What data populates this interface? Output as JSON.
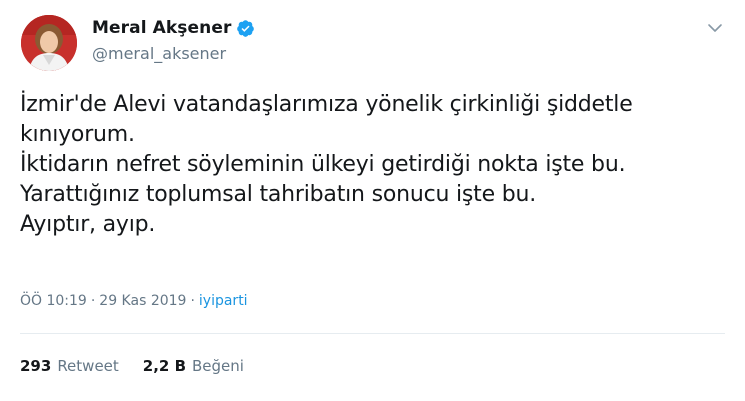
{
  "user": {
    "display_name": "Meral Akşener",
    "handle": "@meral_aksener",
    "verified": true
  },
  "tweet": {
    "lines": [
      "İzmir'de Alevi vatandaşlarımıza yönelik çirkinliği şiddetle",
      "kınıyorum.",
      "İktidarın nefret söyleminin ülkeyi getirdiği nokta işte bu.",
      "Yarattığınız toplumsal tahribatın sonucu işte bu.",
      "Ayıptır, ayıp."
    ]
  },
  "meta": {
    "time": "ÖÖ 10:19",
    "separator": "·",
    "date": "29 Kas 2019",
    "source": "iyiparti"
  },
  "stats": {
    "retweets_count": "293",
    "retweets_label": "Retweet",
    "likes_count": "2,2 B",
    "likes_label": "Beğeni"
  },
  "colors": {
    "accent": "#1da1f2",
    "link": "#1b95e0",
    "secondary_text": "#657786",
    "divider": "#e6ecf0"
  },
  "icons": {
    "verified": "verified-badge-icon",
    "menu": "chevron-down-icon"
  }
}
